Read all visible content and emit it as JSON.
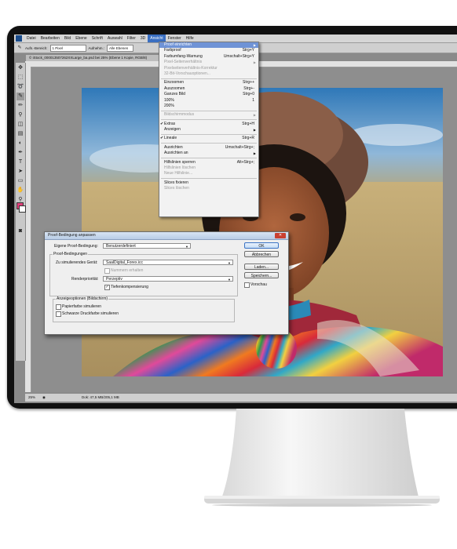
{
  "menubar": {
    "items": [
      "Datei",
      "Bearbeiten",
      "Bild",
      "Ebene",
      "Schrift",
      "Auswahl",
      "Filter",
      "3D",
      "Ansicht",
      "Fenster",
      "Hilfe"
    ],
    "active": "Ansicht"
  },
  "options_bar": {
    "area_label": "Aufn.-Bereich:",
    "area_value": "1 Pixel",
    "sample_label": "Aufnehm.:",
    "sample_value": "Alle Ebenen"
  },
  "document": {
    "tab_title": "© iStock_000013507262XXLarge_ba.psd bei 25% (Ebene 1 Kopie, RGB/8)"
  },
  "view_menu": {
    "items": [
      {
        "label": "Proof einrichten",
        "shortcut": "",
        "state": "highlighted",
        "submenu": true
      },
      {
        "label": "Farbproof",
        "shortcut": "Strg+Y",
        "state": "normal"
      },
      {
        "label": "Farbumfang-Warnung",
        "shortcut": "Umschalt+Strg+Y",
        "state": "normal"
      },
      {
        "label": "Pixel-Seitenverhältnis",
        "shortcut": "",
        "state": "disabled",
        "submenu": true
      },
      {
        "label": "Pixelseitenverhältnis-Korrektur",
        "shortcut": "",
        "state": "disabled"
      },
      {
        "label": "32-Bit-Vorschauoptionen...",
        "shortcut": "",
        "state": "disabled"
      },
      {
        "sep": true
      },
      {
        "label": "Einzoomen",
        "shortcut": "Strg++",
        "state": "normal"
      },
      {
        "label": "Auszoomen",
        "shortcut": "Strg+-",
        "state": "normal"
      },
      {
        "label": "Ganzes Bild",
        "shortcut": "Strg+0",
        "state": "normal"
      },
      {
        "label": "100%",
        "shortcut": "1",
        "state": "normal"
      },
      {
        "label": "200%",
        "shortcut": "",
        "state": "normal"
      },
      {
        "sep": true
      },
      {
        "label": "Bildschirmmodus",
        "shortcut": "",
        "state": "disabled",
        "submenu": true
      },
      {
        "sep": true
      },
      {
        "label": "Extras",
        "shortcut": "Strg+H",
        "state": "normal",
        "checked": true
      },
      {
        "label": "Anzeigen",
        "shortcut": "",
        "state": "normal",
        "submenu": true
      },
      {
        "sep": true
      },
      {
        "label": "Lineale",
        "shortcut": "Strg+R",
        "state": "normal",
        "checked": true
      },
      {
        "sep": true
      },
      {
        "label": "Ausrichten",
        "shortcut": "Umschalt+Strg+;",
        "state": "normal"
      },
      {
        "label": "Ausrichten an",
        "shortcut": "",
        "state": "normal",
        "submenu": true
      },
      {
        "sep": true
      },
      {
        "label": "Hilfslinien sperren",
        "shortcut": "Alt+Strg+;",
        "state": "normal"
      },
      {
        "label": "Hilfslinien löschen",
        "shortcut": "",
        "state": "disabled"
      },
      {
        "label": "Neue Hilfslinie...",
        "shortcut": "",
        "state": "disabled"
      },
      {
        "sep": true
      },
      {
        "label": "Slices fixieren",
        "shortcut": "",
        "state": "normal"
      },
      {
        "label": "Slices löschen",
        "shortcut": "",
        "state": "disabled"
      }
    ]
  },
  "dialog": {
    "title": "Proof-Bedingung anpassen",
    "custom_label": "Eigene Proof-Bedingung:",
    "custom_value": "Benutzerdefiniert",
    "group_proof": "Proof-Bedingungen",
    "device_label": "Zu simulierendes Gerät:",
    "device_value": "SaalDigital_Forex.icc",
    "keep_numbers": "Nummern erhalten",
    "intent_label": "Renderpriorität:",
    "intent_value": "Perzeptiv",
    "bpc": "Tiefenkompensierung",
    "group_display": "Anzeigeoptionen (Bildschirm)",
    "paper_color": "Papierfarbe simulieren",
    "black_ink": "Schwarze Druckfarbe simulieren",
    "preview": "Vorschau",
    "buttons": {
      "ok": "OK",
      "cancel": "Abbrechen",
      "load": "Laden...",
      "save": "Speichern..."
    }
  },
  "statusbar": {
    "zoom": "25%",
    "doc_info": "Dok: 47,5 MB/205,1 MB"
  }
}
